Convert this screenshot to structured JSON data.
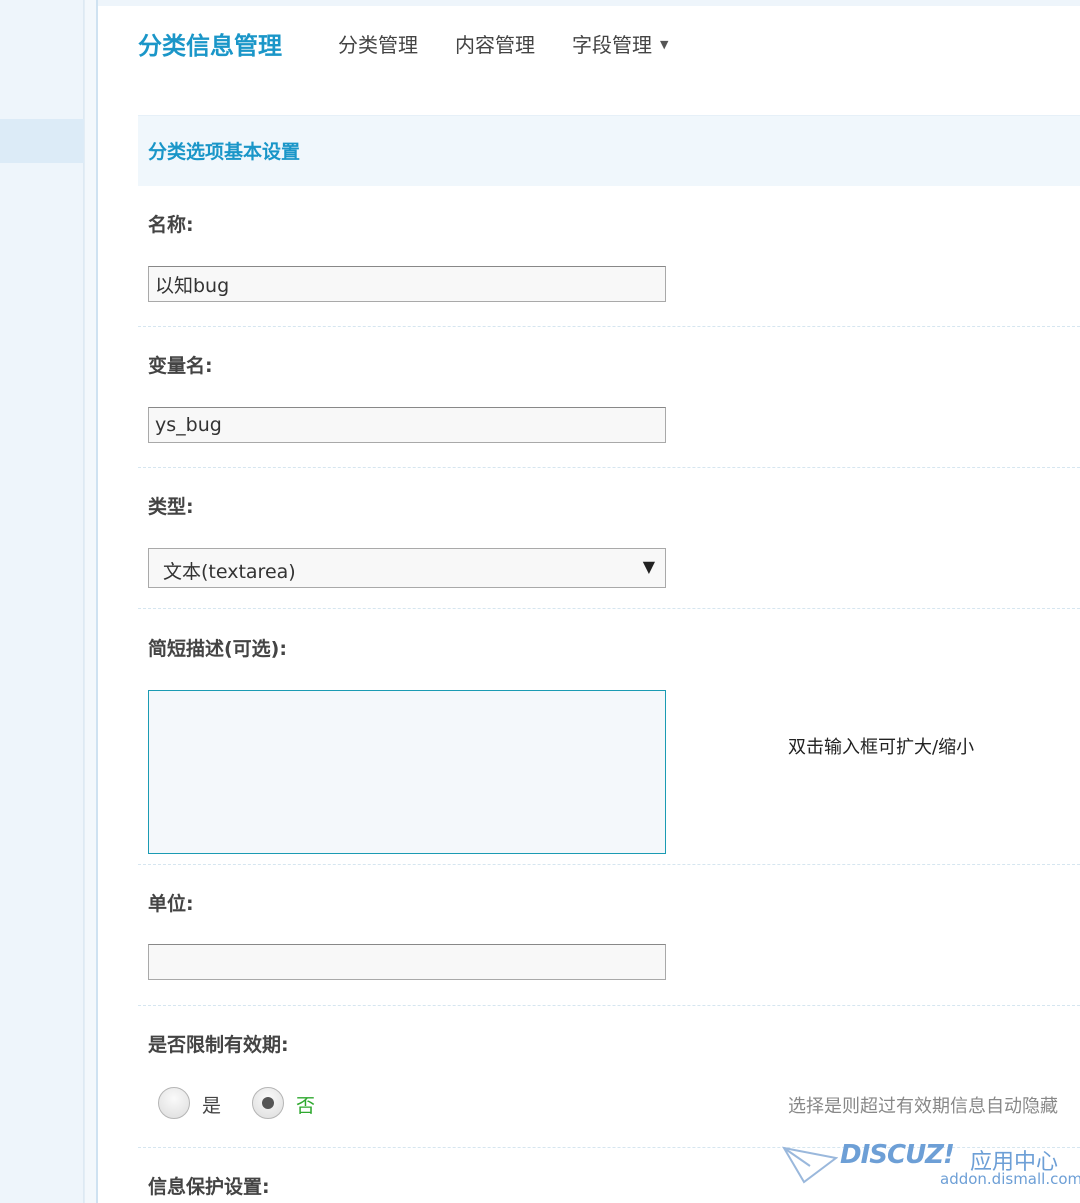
{
  "nav": {
    "title": "分类信息管理",
    "items": [
      "分类管理",
      "内容管理",
      "字段管理"
    ]
  },
  "section": {
    "title": "分类选项基本设置"
  },
  "fields": {
    "name": {
      "label": "名称:",
      "value": "以知bug"
    },
    "var_name": {
      "label": "变量名:",
      "value": "ys_bug"
    },
    "type": {
      "label": "类型:",
      "selected": "文本(textarea)"
    },
    "description": {
      "label": "简短描述(可选):",
      "value": "",
      "tip": "双击输入框可扩大/缩小"
    },
    "unit": {
      "label": "单位:",
      "value": ""
    },
    "expiry": {
      "label": "是否限制有效期:",
      "options": [
        "是",
        "否"
      ],
      "selected": "否",
      "tip": "选择是则超过有效期信息自动隐藏"
    },
    "protect": {
      "label": "信息保护设置:"
    }
  },
  "colors": {
    "accent": "#1a96c8",
    "selected_option": "#2fa82f"
  },
  "watermark": {
    "logo": "DISCUZ!",
    "subtitle": "应用中心",
    "url": "addon.dismall.com"
  }
}
